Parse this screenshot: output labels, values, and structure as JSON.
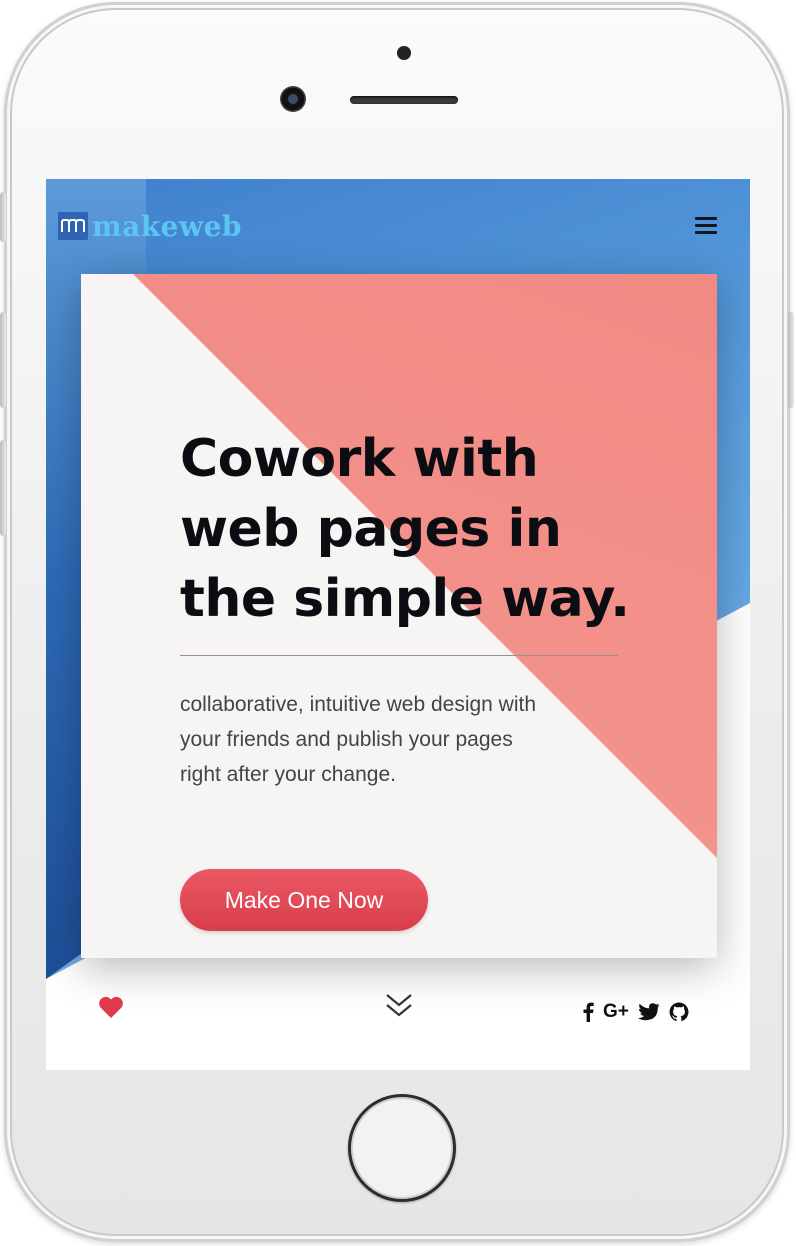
{
  "app": {
    "logo_text": "makeweb",
    "menu_icon": "hamburger-menu-icon"
  },
  "hero": {
    "headline_lines": [
      "Cowork with",
      "web pages in",
      "the simple way."
    ],
    "description_lines": [
      "collaborative, intuitive web design with",
      "your friends and publish your pages",
      "right after your change."
    ],
    "cta_label": "Make One Now"
  },
  "footer": {
    "like_icon": "heart-icon",
    "scroll_icon": "double-chevron-down-icon",
    "social": [
      {
        "name": "facebook-icon"
      },
      {
        "name": "google-plus-icon",
        "label": "G+"
      },
      {
        "name": "twitter-icon"
      },
      {
        "name": "github-icon"
      }
    ]
  },
  "colors": {
    "accent_blue": "#5a9ede",
    "accent_pink": "#f28a84",
    "cta_red": "#e14957",
    "heart_red": "#e0394a",
    "logo_cyan": "#5cc6f3"
  }
}
